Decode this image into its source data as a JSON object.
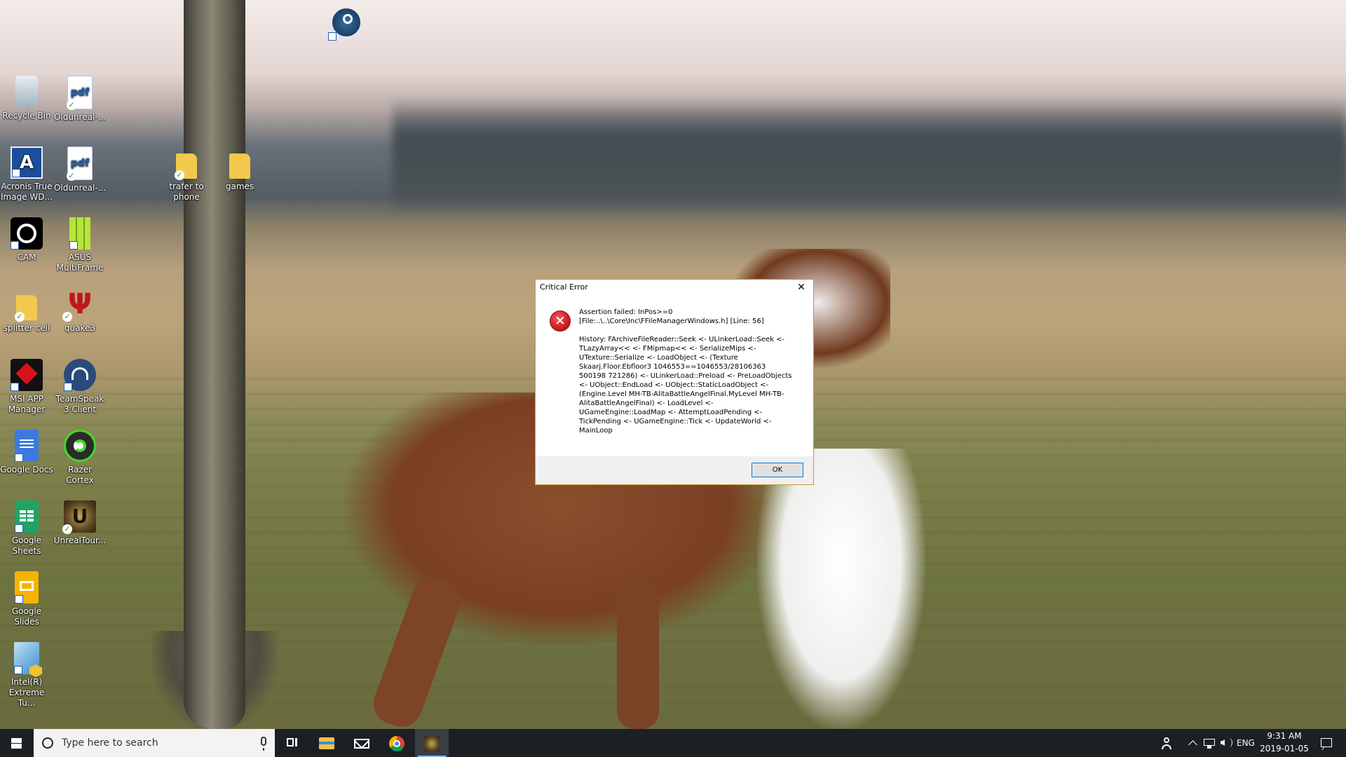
{
  "desktop": {
    "icons": [
      {
        "label": "Recycle Bin"
      },
      {
        "label": "Oldunreal-..."
      },
      {
        "label": "Acronis True Image WD..."
      },
      {
        "label": "Oldunreal-..."
      },
      {
        "label": "trafer to phone"
      },
      {
        "label": "games"
      },
      {
        "label": "CAM"
      },
      {
        "label": "ASUS MultiFrame"
      },
      {
        "label": "splitter cell"
      },
      {
        "label": "quake3"
      },
      {
        "label": "MSI APP Manager"
      },
      {
        "label": "TeamSpeak 3 Client"
      },
      {
        "label": "Google Docs"
      },
      {
        "label": "Razer Cortex"
      },
      {
        "label": "Google Sheets"
      },
      {
        "label": "UnrealTour..."
      },
      {
        "label": "Google Slides"
      },
      {
        "label": "Intel(R) Extreme Tu..."
      }
    ]
  },
  "dialog": {
    "title": "Critical Error",
    "line1": "Assertion failed: InPos>=0",
    "line2": "[File:..\\..\\Core\\Inc\\FFileManagerWindows.h] [Line: 56]",
    "history": "History: FArchiveFileReader::Seek <- ULinkerLoad::Seek <- TLazyArray<< <- FMipmap<< <- SerializeMips <- UTexture::Serialize <- LoadObject <- (Texture Skaarj.Floor.Ebfloor3 1046553==1046553/28106363 500198 721286) <- ULinkerLoad::Preload <- PreLoadObjects <- UObject::EndLoad <- UObject::StaticLoadObject <- (Engine.Level MH-TB-AlitaBattleAngelFinal.MyLevel MH-TB-AlitaBattleAngelFinal) <- LoadLevel <- UGameEngine::LoadMap <- AttemptLoadPending <- TickPending <- UGameEngine::Tick <- UpdateWorld <- MainLoop",
    "ok_label": "OK",
    "close_glyph": "✕",
    "error_glyph": "✕"
  },
  "taskbar": {
    "search_placeholder": "Type here to search",
    "language": "ENG",
    "time": "9:31 AM",
    "date": "2019-01-05"
  }
}
